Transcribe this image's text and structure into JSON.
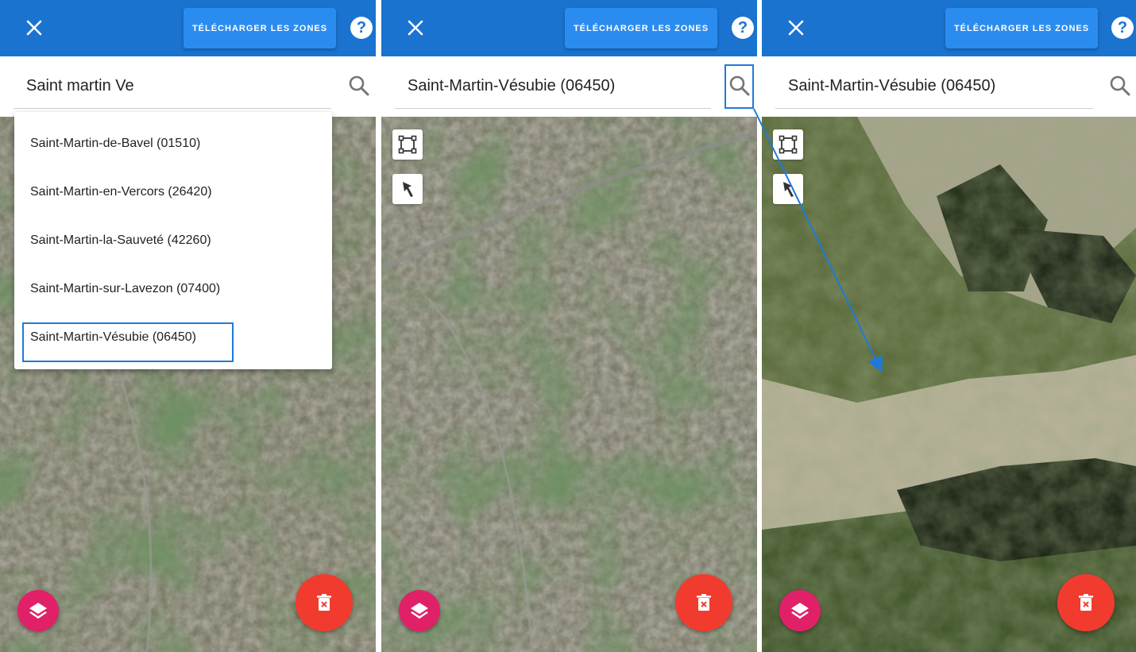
{
  "app": {
    "download_label": "TÉLÉCHARGER LES ZONES",
    "help_label": "?"
  },
  "icons": {
    "close": "close-icon",
    "search": "search-icon",
    "draw_zone": "draw-zone-icon",
    "pin": "pin-icon",
    "layers": "layers-icon",
    "trash": "trash-icon"
  },
  "colors": {
    "topbar": "#1a73cf",
    "accent_button": "#2b8cf0",
    "layers_button": "#e02168",
    "trash_button": "#f23b2f",
    "annotation": "#1e7ad8"
  },
  "panels": [
    {
      "search_value": "Saint martin Ve",
      "suggestions": [
        "Saint-Martin-de-Bavel (01510)",
        "Saint-Martin-en-Vercors (26420)",
        "Saint-Martin-la-Sauveté (42260)",
        "Saint-Martin-sur-Lavezon (07400)",
        "Saint-Martin-Vésubie (06450)"
      ],
      "selected_suggestion": "Saint-Martin-Vésubie (06450)"
    },
    {
      "search_value": "Saint-Martin-Vésubie (06450)"
    },
    {
      "search_value": "Saint-Martin-Vésubie (06450)"
    }
  ]
}
